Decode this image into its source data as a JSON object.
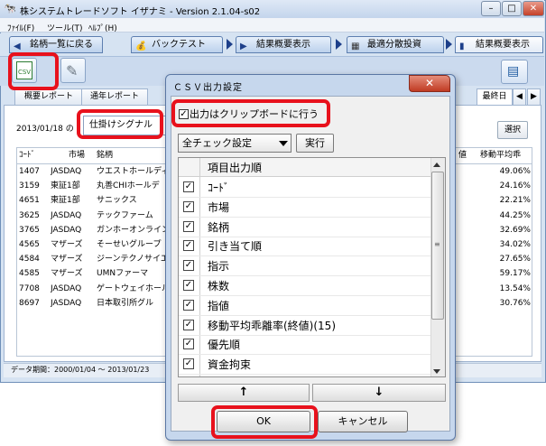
{
  "window": {
    "title": "株システムトレードソフト イザナミ - Version 2.1.04-s02",
    "buttons": {
      "minimize": "–",
      "maximize": "□",
      "close": "✕"
    }
  },
  "menu": [
    "ﾌｧｲﾙ(F)",
    "ツール(T)",
    "ﾍﾙﾌﾟ(H)"
  ],
  "nav": {
    "back": "銘柄一覧に戻る",
    "backtest": "バックテスト",
    "summary": "結果概要表示",
    "optimal": "最適分散投資",
    "summary2": "結果概要表示"
  },
  "toolbar": {
    "csv_label": "CSV"
  },
  "tabs": [
    "概要レポート",
    "通年レポート",
    "最終日"
  ],
  "content": {
    "date": "2013/01/18 の",
    "signal": "仕掛けシグナル",
    "select": "選択",
    "columns": [
      "ｺｰﾄﾞ",
      "市場",
      "銘柄",
      "値",
      "移動平均乖"
    ],
    "rows": [
      [
        "1407",
        "JASDAQ",
        "ウエストホールディ",
        "49.06%"
      ],
      [
        "3159",
        "東証1部",
        "丸善CHIホールデ",
        "24.16%"
      ],
      [
        "4651",
        "東証1部",
        "サニックス",
        "22.21%"
      ],
      [
        "3625",
        "JASDAQ",
        "テックファーム",
        "44.25%"
      ],
      [
        "3765",
        "JASDAQ",
        "ガンホーオンライン",
        "32.69%"
      ],
      [
        "4565",
        "マザーズ",
        "そーせいグループ",
        "34.02%"
      ],
      [
        "4584",
        "マザーズ",
        "ジーンテクノサイエ",
        "27.65%"
      ],
      [
        "4585",
        "マザーズ",
        "UMNファーマ",
        "59.17%"
      ],
      [
        "7708",
        "JASDAQ",
        "ゲートウェイホール",
        "13.54%"
      ],
      [
        "8697",
        "JASDAQ",
        "日本取引所グル",
        "30.76%"
      ]
    ]
  },
  "status": "データ期間：2000/01/04 〜 2013/01/23",
  "dialog": {
    "title": "ＣＳＶ出力設定",
    "close": "✕",
    "clipboard_label": "出力はクリップボードに行う",
    "clipboard_checked": true,
    "allcheck": "全チェック設定",
    "exec": "実行",
    "list_header": "項目出力順",
    "items": [
      "ｺｰﾄﾞ",
      "市場",
      "銘柄",
      "引き当て順",
      "指示",
      "株数",
      "指値",
      "移動平均乖離率(終値)(15)",
      "優先順",
      "資金拘束"
    ],
    "up": "↑",
    "down": "↓",
    "ok": "OK",
    "cancel": "キャンセル"
  },
  "colors": {
    "highlight": "#e8111c",
    "accent": "#1d3f8a"
  }
}
